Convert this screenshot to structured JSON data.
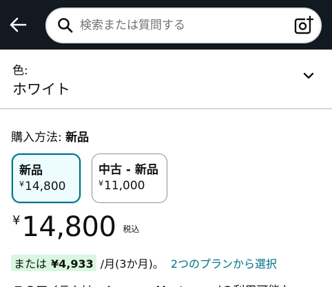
{
  "search": {
    "placeholder": "検索または質問する"
  },
  "color": {
    "label": "色:",
    "value": "ホワイト"
  },
  "purchase": {
    "label": "購入方法:",
    "value": "新品"
  },
  "options": [
    {
      "title": "新品",
      "currency": "¥",
      "price": "14,800",
      "selected": true
    },
    {
      "title": "中古 - 新品",
      "currency": "¥",
      "price": "11,000",
      "selected": false
    }
  ],
  "price": {
    "currency": "¥",
    "amount": "14,800",
    "tax_label": "税込"
  },
  "installment": {
    "prefix": "または",
    "amount": "¥4,933",
    "period": "/月(3か月)。",
    "link_text": "2つのプランから選択"
  },
  "footer_cut_text": "このアイテムは、Amazon Mastercardの利用可能な...",
  "colors": {
    "topbar": "#131921",
    "accent": "#007185",
    "highlight": "#d9f7e0"
  },
  "icons": {
    "back": "arrow-left-icon",
    "search": "search-icon",
    "camera": "camera-lens-icon",
    "chevron": "chevron-down-icon"
  }
}
